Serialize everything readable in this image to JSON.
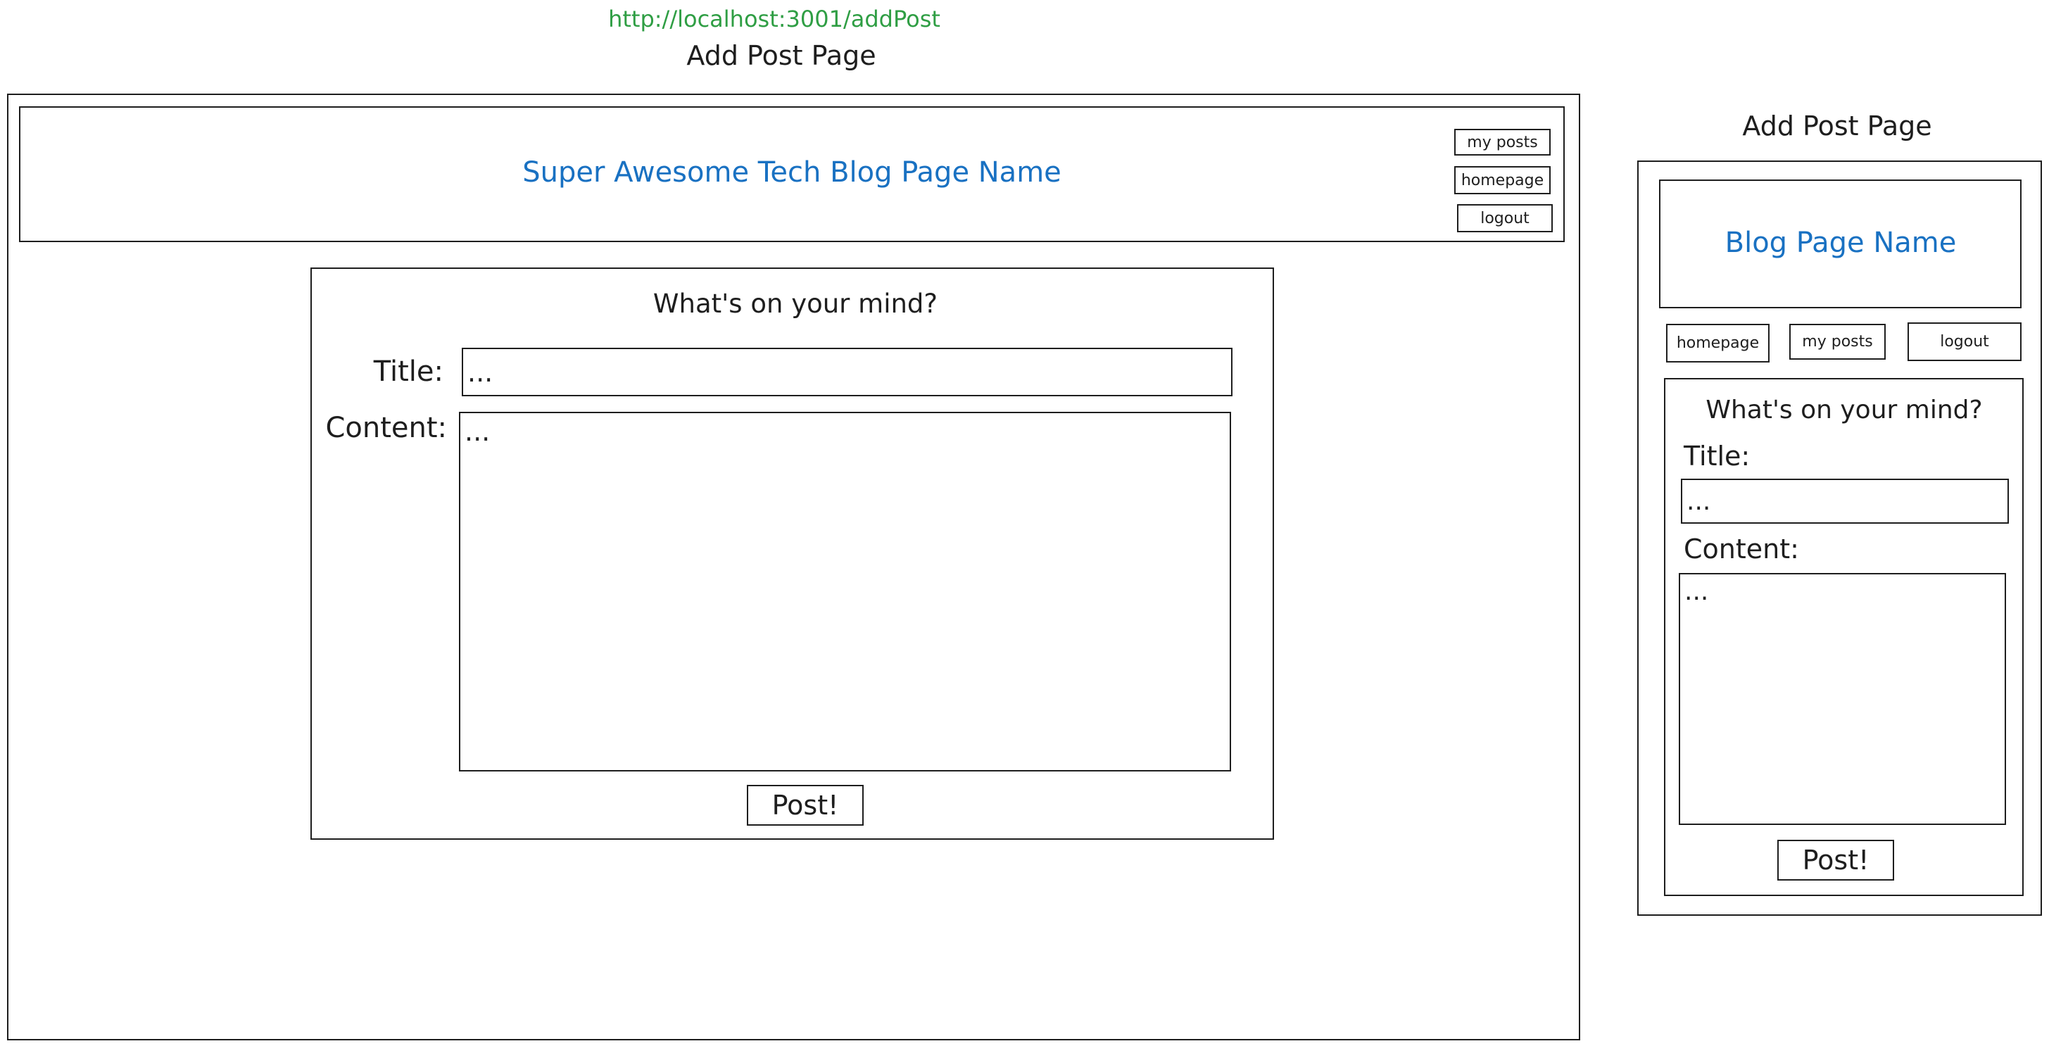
{
  "url": "http://localhost:3001/addPost",
  "colors": {
    "url_green": "#2f9e44",
    "blog_name_blue": "#1971c2",
    "stroke": "#1e1e1e"
  },
  "desktop": {
    "page_title": "Add Post Page",
    "header": {
      "blog_name": "Super Awesome Tech Blog Page Name",
      "nav": {
        "my_posts": "my posts",
        "homepage": "homepage",
        "logout": "logout"
      }
    },
    "form": {
      "question": "What's on your mind?",
      "title_label": "Title:",
      "title_value": "...",
      "content_label": "Content:",
      "content_value": "...",
      "submit": "Post!"
    }
  },
  "mobile": {
    "page_title": "Add Post Page",
    "header": {
      "blog_name": "Blog Page Name",
      "nav": {
        "homepage": "homepage",
        "my_posts": "my posts",
        "logout": "logout"
      }
    },
    "form": {
      "question": "What's on your mind?",
      "title_label": "Title:",
      "title_value": "...",
      "content_label": "Content:",
      "content_value": "...",
      "submit": "Post!"
    }
  }
}
